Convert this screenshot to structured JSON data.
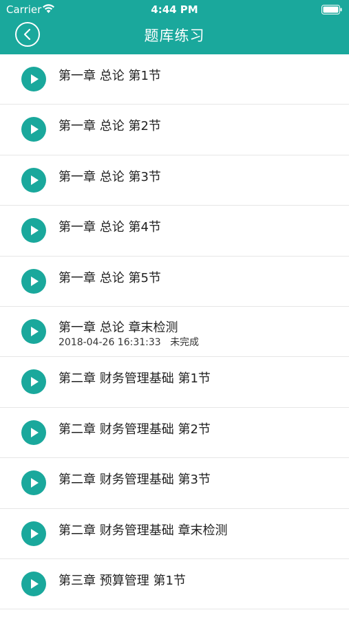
{
  "status_bar": {
    "carrier": "Carrier",
    "time": "4:44 PM"
  },
  "header": {
    "title": "题库练习"
  },
  "items": [
    {
      "title": "第一章 总论 第1节"
    },
    {
      "title": "第一章 总论 第2节"
    },
    {
      "title": "第一章 总论 第3节"
    },
    {
      "title": "第一章 总论 第4节"
    },
    {
      "title": "第一章 总论 第5节"
    },
    {
      "title": "第一章 总论 章末检测",
      "date": "2018-04-26 16:31:33",
      "status": "未完成"
    },
    {
      "title": "第二章 财务管理基础 第1节"
    },
    {
      "title": "第二章 财务管理基础 第2节"
    },
    {
      "title": "第二章 财务管理基础 第3节"
    },
    {
      "title": "第二章 财务管理基础 章末检测"
    },
    {
      "title": "第三章 预算管理 第1节"
    }
  ],
  "colors": {
    "accent": "#1aa89c"
  }
}
